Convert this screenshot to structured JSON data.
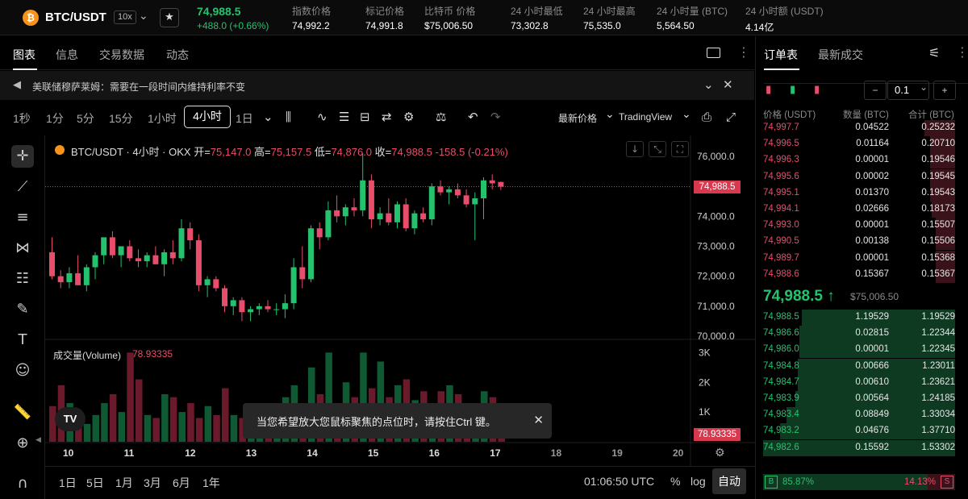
{
  "header": {
    "coin_symbol": "₿",
    "pair": "BTC/USDT",
    "leverage": "10x",
    "last_price": "74,988.5",
    "change": "+488.0 (+0.66%)",
    "stats": [
      {
        "label": "指数价格",
        "value": "74,992.2"
      },
      {
        "label": "标记价格",
        "value": "74,991.8"
      },
      {
        "label": "比特币 价格",
        "value": "$75,006.50"
      },
      {
        "label": "24 小时最低",
        "value": "73,302.8"
      },
      {
        "label": "24 小时最高",
        "value": "75,535.0"
      },
      {
        "label": "24 小时量 (BTC)",
        "value": "5,564.50"
      },
      {
        "label": "24 小时额 (USDT)",
        "value": "4.14亿"
      }
    ]
  },
  "tabs": [
    "图表",
    "信息",
    "交易数据",
    "动态"
  ],
  "notice": "美联储穆萨莱姆：需要在一段时间内维持利率不变",
  "timeframes": [
    "1秒",
    "1分",
    "5分",
    "15分",
    "1小时",
    "4小时",
    "1日"
  ],
  "toolbar": {
    "price_type": "最新价格",
    "source": "TradingView"
  },
  "chart": {
    "legend_title": "BTC/USDT · 4小时 · OKX",
    "open_label": "开=",
    "open": "75,147.0",
    "high_label": "高=",
    "high": "75,157.5",
    "low_label": "低=",
    "low": "74,876.0",
    "close_label": "收=",
    "close": "74,988.5",
    "change": "-158.5 (-0.21%)",
    "volume_label": "成交量(Volume)",
    "volume_value": "78.93335",
    "price_axis": [
      "76,000.0",
      "75,000.0",
      "74,000.0",
      "73,000.0",
      "72,000.0",
      "71,000.0",
      "70,000.0"
    ],
    "volume_axis": [
      "3K",
      "2K",
      "1K"
    ],
    "date_axis": [
      "10",
      "11",
      "12",
      "13",
      "14",
      "15",
      "16",
      "17",
      "18",
      "19",
      "20"
    ],
    "last_price_tag": "74,988.5",
    "volume_tag": "78.93335",
    "tradingview_logo": "TV",
    "tooltip": "当您希望放大您鼠标聚焦的点位时，请按住Ctrl 键。"
  },
  "chart_data": {
    "type": "candlestick",
    "interval": "4h",
    "ylim": [
      70000,
      76200
    ],
    "last_price": 74988.5,
    "candles": [
      {
        "o": 72800,
        "h": 73300,
        "l": 71900,
        "c": 72000
      },
      {
        "o": 72000,
        "h": 72200,
        "l": 71600,
        "c": 71800
      },
      {
        "o": 71800,
        "h": 72300,
        "l": 71600,
        "c": 72100
      },
      {
        "o": 72100,
        "h": 72700,
        "l": 71800,
        "c": 71700
      },
      {
        "o": 71700,
        "h": 72400,
        "l": 71500,
        "c": 72300
      },
      {
        "o": 72300,
        "h": 72800,
        "l": 71900,
        "c": 72700
      },
      {
        "o": 72700,
        "h": 73200,
        "l": 72400,
        "c": 73300
      },
      {
        "o": 73300,
        "h": 73500,
        "l": 72600,
        "c": 72700
      },
      {
        "o": 72700,
        "h": 73000,
        "l": 72300,
        "c": 73000
      },
      {
        "o": 73000,
        "h": 73200,
        "l": 72500,
        "c": 72600
      },
      {
        "o": 72600,
        "h": 72900,
        "l": 72300,
        "c": 72500
      },
      {
        "o": 72500,
        "h": 72800,
        "l": 72300,
        "c": 72700
      },
      {
        "o": 72700,
        "h": 73000,
        "l": 72400,
        "c": 72400
      },
      {
        "o": 72400,
        "h": 72900,
        "l": 72000,
        "c": 72800
      },
      {
        "o": 72800,
        "h": 73200,
        "l": 72400,
        "c": 72600
      },
      {
        "o": 72600,
        "h": 73900,
        "l": 72500,
        "c": 73600
      },
      {
        "o": 73600,
        "h": 73800,
        "l": 72900,
        "c": 73200
      },
      {
        "o": 73200,
        "h": 73400,
        "l": 71500,
        "c": 71700
      },
      {
        "o": 71700,
        "h": 72000,
        "l": 71300,
        "c": 71900
      },
      {
        "o": 71900,
        "h": 72000,
        "l": 71500,
        "c": 71600
      },
      {
        "o": 71600,
        "h": 71700,
        "l": 70800,
        "c": 71000
      },
      {
        "o": 71000,
        "h": 71300,
        "l": 70700,
        "c": 71200
      },
      {
        "o": 71200,
        "h": 71300,
        "l": 70500,
        "c": 70800
      },
      {
        "o": 70800,
        "h": 71000,
        "l": 70500,
        "c": 70900
      },
      {
        "o": 70900,
        "h": 71100,
        "l": 70700,
        "c": 71000
      },
      {
        "o": 71000,
        "h": 71200,
        "l": 70800,
        "c": 70900
      },
      {
        "o": 70900,
        "h": 71100,
        "l": 70700,
        "c": 70900
      },
      {
        "o": 70900,
        "h": 71400,
        "l": 70600,
        "c": 71100
      },
      {
        "o": 71100,
        "h": 72600,
        "l": 70900,
        "c": 72300
      },
      {
        "o": 72300,
        "h": 73000,
        "l": 71600,
        "c": 71900
      },
      {
        "o": 71900,
        "h": 73700,
        "l": 71800,
        "c": 73600
      },
      {
        "o": 73600,
        "h": 73800,
        "l": 72900,
        "c": 73300
      },
      {
        "o": 73300,
        "h": 74500,
        "l": 73200,
        "c": 74200
      },
      {
        "o": 74200,
        "h": 74700,
        "l": 73800,
        "c": 74000
      },
      {
        "o": 74000,
        "h": 74400,
        "l": 73700,
        "c": 74300
      },
      {
        "o": 74300,
        "h": 74600,
        "l": 74000,
        "c": 74200
      },
      {
        "o": 74200,
        "h": 76100,
        "l": 74000,
        "c": 75200
      },
      {
        "o": 75200,
        "h": 75400,
        "l": 73600,
        "c": 73900
      },
      {
        "o": 73900,
        "h": 74300,
        "l": 73700,
        "c": 74100
      },
      {
        "o": 74100,
        "h": 74600,
        "l": 73700,
        "c": 73800
      },
      {
        "o": 73800,
        "h": 74500,
        "l": 73600,
        "c": 74400
      },
      {
        "o": 74400,
        "h": 74600,
        "l": 73500,
        "c": 73600
      },
      {
        "o": 73600,
        "h": 74200,
        "l": 73400,
        "c": 74100
      },
      {
        "o": 74100,
        "h": 74300,
        "l": 73800,
        "c": 73900
      },
      {
        "o": 73900,
        "h": 75100,
        "l": 73700,
        "c": 75000
      },
      {
        "o": 75000,
        "h": 75200,
        "l": 74700,
        "c": 74800
      },
      {
        "o": 74800,
        "h": 75000,
        "l": 74400,
        "c": 74900
      },
      {
        "o": 74900,
        "h": 75100,
        "l": 74600,
        "c": 74700
      },
      {
        "o": 74700,
        "h": 74900,
        "l": 74300,
        "c": 74400
      },
      {
        "o": 74400,
        "h": 74800,
        "l": 73200,
        "c": 74600
      },
      {
        "o": 74600,
        "h": 75300,
        "l": 73900,
        "c": 75200
      },
      {
        "o": 75200,
        "h": 75400,
        "l": 74900,
        "c": 75100
      },
      {
        "o": 75147,
        "h": 75157.5,
        "l": 74876,
        "c": 74988.5
      }
    ],
    "volumes": [
      1200,
      1900,
      1300,
      700,
      600,
      900,
      1300,
      1600,
      1000,
      3000,
      2100,
      900,
      800,
      1600,
      1500,
      1000,
      1300,
      800,
      1200,
      900,
      1800,
      900,
      800,
      600,
      1300,
      1000,
      1200,
      1500,
      1900,
      1300,
      2500,
      1600,
      3000,
      1200,
      2000,
      1500,
      3000,
      1800,
      2700,
      1500,
      1900,
      2100,
      1400,
      1700,
      1300,
      1700,
      1900,
      1600,
      1300,
      1200,
      1700,
      1500,
      900
    ],
    "volume_max": 3200
  },
  "bottom": {
    "ranges": [
      "1日",
      "5日",
      "1月",
      "3月",
      "6月",
      "1年"
    ],
    "time": "01:06:50 UTC",
    "percent": "%",
    "log": "log",
    "auto": "自动"
  },
  "orderbook": {
    "tabs": [
      "订单表",
      "最新成交"
    ],
    "tick": "0.1",
    "headers": [
      "价格 (USDT)",
      "数量 (BTC)",
      "合计 (BTC)"
    ],
    "asks": [
      {
        "price": "74,997.7",
        "qty": "0.04522",
        "total": "0.25232",
        "depth": 0.16
      },
      {
        "price": "74,996.5",
        "qty": "0.01164",
        "total": "0.20710",
        "depth": 0.13
      },
      {
        "price": "74,996.3",
        "qty": "0.00001",
        "total": "0.19546",
        "depth": 0.13
      },
      {
        "price": "74,995.6",
        "qty": "0.00002",
        "total": "0.19545",
        "depth": 0.13
      },
      {
        "price": "74,995.1",
        "qty": "0.01370",
        "total": "0.19543",
        "depth": 0.13
      },
      {
        "price": "74,994.1",
        "qty": "0.02666",
        "total": "0.18173",
        "depth": 0.12
      },
      {
        "price": "74,993.0",
        "qty": "0.00001",
        "total": "0.15507",
        "depth": 0.1
      },
      {
        "price": "74,990.5",
        "qty": "0.00138",
        "total": "0.15506",
        "depth": 0.1
      },
      {
        "price": "74,989.7",
        "qty": "0.00001",
        "total": "0.15368",
        "depth": 0.1
      },
      {
        "price": "74,988.6",
        "qty": "0.15367",
        "total": "0.15367",
        "depth": 0.1
      }
    ],
    "mid_price": "74,988.5",
    "mid_arrow": "↑",
    "mid_usd": "$75,006.50",
    "bids": [
      {
        "price": "74,988.5",
        "qty": "1.19529",
        "total": "1.19529",
        "depth": 0.8
      },
      {
        "price": "74,986.6",
        "qty": "0.02815",
        "total": "1.22344",
        "depth": 0.81
      },
      {
        "price": "74,986.0",
        "qty": "0.00001",
        "total": "1.22345",
        "depth": 0.81
      },
      {
        "price": "74,984.8",
        "qty": "0.00666",
        "total": "1.23011",
        "depth": 0.82
      },
      {
        "price": "74,984.7",
        "qty": "0.00610",
        "total": "1.23621",
        "depth": 0.82
      },
      {
        "price": "74,983.9",
        "qty": "0.00564",
        "total": "1.24185",
        "depth": 0.83
      },
      {
        "price": "74,983.4",
        "qty": "0.08849",
        "total": "1.33034",
        "depth": 0.88
      },
      {
        "price": "74,983.2",
        "qty": "0.04676",
        "total": "1.37710",
        "depth": 0.91
      },
      {
        "price": "74,982.6",
        "qty": "0.15592",
        "total": "1.53302",
        "depth": 1.0
      }
    ],
    "buy_label": "B",
    "buy_pct": "85.87%",
    "sell_pct": "14.13%",
    "sell_label": "S",
    "buy_ratio": 0.8587
  },
  "colors": {
    "up": "#25c26e",
    "down": "#e84d6b",
    "bg": "#000000"
  }
}
